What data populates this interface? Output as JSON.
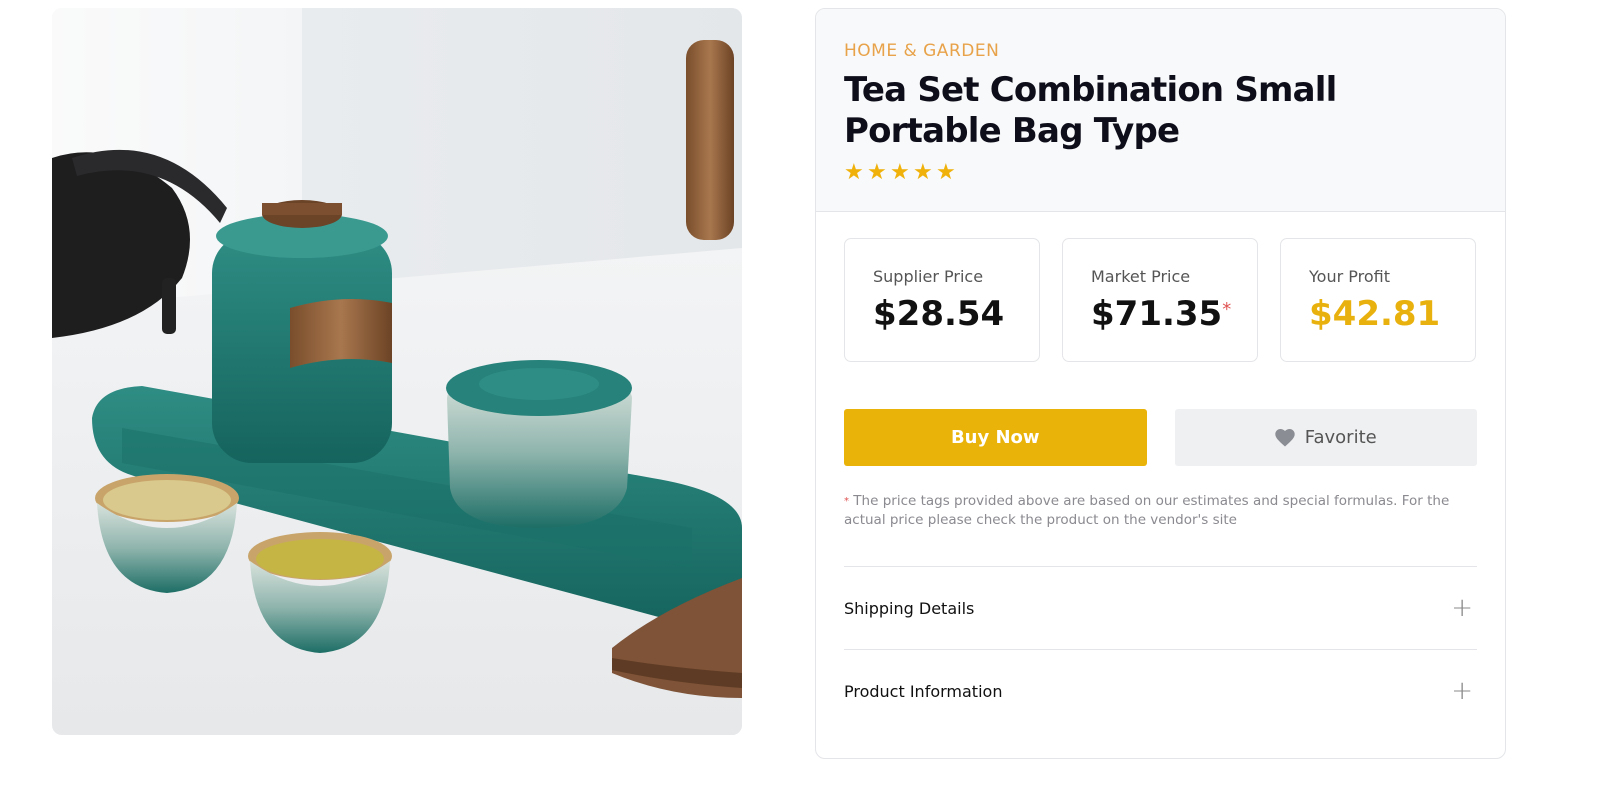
{
  "product": {
    "category": "HOME & GARDEN",
    "title": "Tea Set Combination Small Portable Bag Type",
    "rating": 5,
    "rating_max": 5
  },
  "prices": {
    "supplier": {
      "label": "Supplier Price",
      "value": "$28.54"
    },
    "market": {
      "label": "Market Price",
      "value": "$71.35",
      "marker": "*"
    },
    "profit": {
      "label": "Your Profit",
      "value": "$42.81"
    }
  },
  "actions": {
    "buy_label": "Buy Now",
    "favorite_label": "Favorite"
  },
  "disclaimer": {
    "marker": "*",
    "text": "The price tags provided above are based on our estimates and special formulas. For the actual price please check the product on the vendor's site"
  },
  "accordion": {
    "items": [
      {
        "label": "Shipping Details",
        "icon": "plus-icon"
      },
      {
        "label": "Product Information",
        "icon": "plus-icon"
      }
    ]
  },
  "colors": {
    "accent": "#e9b30a",
    "category": "#e8a34a",
    "star": "#efb10a",
    "asterisk": "#e05252"
  },
  "icons": [
    "star-icon",
    "heart-icon",
    "plus-icon"
  ]
}
